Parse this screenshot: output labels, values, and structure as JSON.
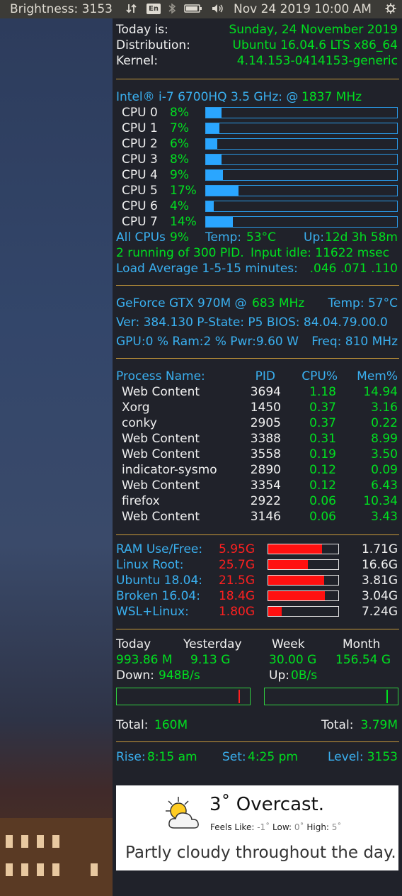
{
  "topbar": {
    "brightness": "Brightness: 3153",
    "lang": "En",
    "datetime": "Nov 24 2019 10:00 AM"
  },
  "sys": {
    "today_label": "Today is:",
    "today_value": "Sunday, 24 November 2019",
    "distro_label": "Distribution:",
    "distro_value": "Ubuntu 16.04.6 LTS x86_64",
    "kernel_label": "Kernel:",
    "kernel_value": "4.14.153-0414153-generic"
  },
  "cpu": {
    "model": "Intel® i-7 6700HQ 3.5 GHz: @",
    "freq": "1837 MHz",
    "cores": [
      {
        "label": "CPU 0",
        "pct": "8%",
        "fill": 0.08
      },
      {
        "label": "CPU 1",
        "pct": "7%",
        "fill": 0.07
      },
      {
        "label": "CPU 2",
        "pct": "6%",
        "fill": 0.06
      },
      {
        "label": "CPU 3",
        "pct": "8%",
        "fill": 0.08
      },
      {
        "label": "CPU 4",
        "pct": "9%",
        "fill": 0.09
      },
      {
        "label": "CPU 5",
        "pct": "17%",
        "fill": 0.17
      },
      {
        "label": "CPU 6",
        "pct": "4%",
        "fill": 0.04
      },
      {
        "label": "CPU 7",
        "pct": "14%",
        "fill": 0.14
      }
    ],
    "all_label": "All CPUs",
    "all_value": "9%",
    "temp_label": "Temp:",
    "temp_value": "53°C",
    "uptime_label": "Up:",
    "uptime_value": "12d 3h 58m",
    "running": "2 running of 300  PID.",
    "idle": "Input idle: 11622 msec",
    "load_label": "Load Average 1-5-15 minutes:",
    "load_value": ".046 .071 .110"
  },
  "gpu": {
    "name": "GeForce GTX 970M @",
    "freq": "683 MHz",
    "temp": "Temp: 57°C",
    "ver_line": "Ver: 384.130  P-State: P5 BIOS: 84.04.79.00.0",
    "usage_line": "GPU:0 % Ram:2 % Pwr:9.60 W",
    "freq_line": "Freq: 810 MHz"
  },
  "proc": {
    "headers": [
      "Process Name:",
      "PID",
      "CPU%",
      "Mem%"
    ],
    "rows": [
      {
        "name": "Web Content",
        "pid": "3694",
        "cpu": "1.18",
        "mem": "14.94"
      },
      {
        "name": "Xorg",
        "pid": "1450",
        "cpu": "0.37",
        "mem": "3.16"
      },
      {
        "name": "conky",
        "pid": "2905",
        "cpu": "0.37",
        "mem": "0.22"
      },
      {
        "name": "Web Content",
        "pid": "3388",
        "cpu": "0.31",
        "mem": "8.99"
      },
      {
        "name": "Web Content",
        "pid": "3558",
        "cpu": "0.19",
        "mem": "3.50"
      },
      {
        "name": "indicator-sysmo",
        "pid": "2890",
        "cpu": "0.12",
        "mem": "0.09"
      },
      {
        "name": "Web Content",
        "pid": "3354",
        "cpu": "0.12",
        "mem": "6.43"
      },
      {
        "name": "firefox",
        "pid": "2922",
        "cpu": "0.06",
        "mem": "10.34"
      },
      {
        "name": "Web Content",
        "pid": "3146",
        "cpu": "0.06",
        "mem": "3.43"
      }
    ]
  },
  "disk": {
    "rows": [
      {
        "label": "RAM Use/Free:",
        "used": "5.95G",
        "free": "1.71G",
        "fill": 0.77
      },
      {
        "label": "Linux Root:",
        "used": "25.7G",
        "free": "16.6G",
        "fill": 0.57
      },
      {
        "label": "Ubuntu 18.04:",
        "used": "21.5G",
        "free": "3.81G",
        "fill": 0.8
      },
      {
        "label": "Broken 16.04:",
        "used": "18.4G",
        "free": "3.04G",
        "fill": 0.81
      },
      {
        "label": "WSL+Linux:",
        "used": "1.80G",
        "free": "7.24G",
        "fill": 0.19
      }
    ]
  },
  "net": {
    "headers": [
      "Today",
      "Yesterday",
      "Week",
      "Month"
    ],
    "values": [
      "993.86 M",
      "9.13 G",
      "30.00 G",
      "156.54 G"
    ],
    "down_label": "Down:",
    "down_value": "948B/s",
    "up_label": "Up:",
    "up_value": "0B/s",
    "total_label": "Total:",
    "total_down": "160M",
    "total_up": "3.79M"
  },
  "sun": {
    "rise_label": "Rise:",
    "rise_value": "8:15 am",
    "set_label": "Set:",
    "set_value": "4:25 pm",
    "level_label": "Level:",
    "level_value": "3153"
  },
  "weather": {
    "headline": "3˚ Overcast.",
    "feels_label": "Feels Like:",
    "feels_value": "-1˚",
    "low_label": "Low:",
    "low_value": "0˚",
    "high_label": "High:",
    "high_value": "5˚",
    "summary": "Partly cloudy throughout the day.",
    "icon": "partly-cloudy-icon"
  },
  "colors": {
    "label": "#3ab0f0",
    "value": "#00e020",
    "alert": "#ff2020",
    "separator": "#c89a3a",
    "panel": "#3c3b37"
  }
}
